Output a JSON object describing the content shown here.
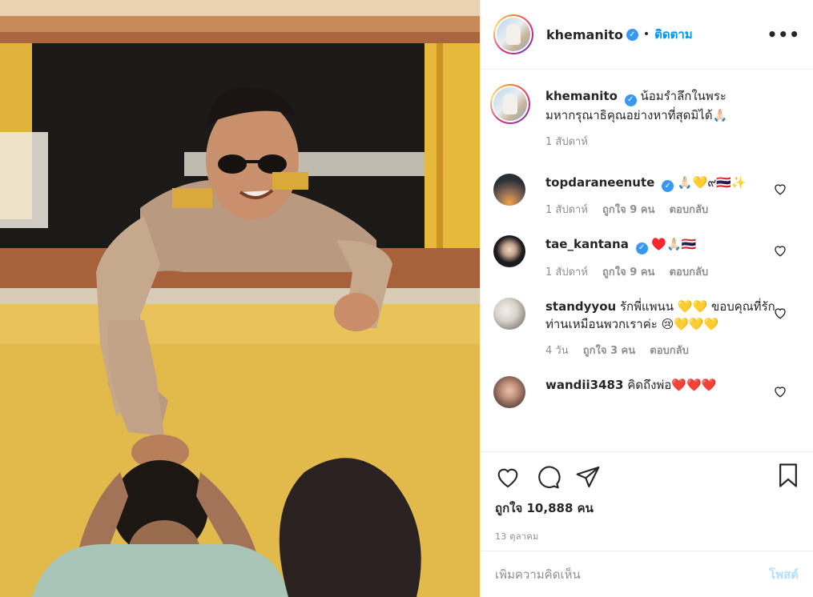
{
  "header": {
    "username": "khemanito",
    "follow_label": "ติดตาม",
    "more_label": "•••"
  },
  "caption": {
    "username": "khemanito",
    "text": "น้อมรำลึกในพระมหากรุณาธิคุณอย่างหาที่สุดมิได้🙏🏻",
    "time": "1 สัปดาห์"
  },
  "comments": [
    {
      "username": "topdaraneenute",
      "verified": true,
      "text": "🙏🏻💛๙🇹🇭✨",
      "time": "1 สัปดาห์",
      "likes": "ถูกใจ 9 คน",
      "reply": "ตอบกลับ"
    },
    {
      "username": "tae_kantana",
      "verified": true,
      "text": "♥️🙏🏻🇹🇭",
      "time": "1 สัปดาห์",
      "likes": "ถูกใจ 9 คน",
      "reply": "ตอบกลับ"
    },
    {
      "username": "standyyou",
      "verified": false,
      "text": "รักพี่แพนน 💛💛 ขอบคุณที่รักท่านเหมือนพวกเราค่ะ 😢💛💛💛",
      "time": "4 วัน",
      "likes": "ถูกใจ 3 คน",
      "reply": "ตอบกลับ"
    },
    {
      "username": "wandii3483",
      "verified": false,
      "text": "คิดถึงพ่อ❤️❤️❤️",
      "time": "",
      "likes": "",
      "reply": ""
    }
  ],
  "actions": {
    "like_count": "ถูกใจ 10,888 คน",
    "date": "13 ตุลาคม"
  },
  "add_comment": {
    "placeholder": "เพิ่มความคิดเห็น",
    "post_label": "โพสต์"
  },
  "colors": {
    "accent": "#0095f6",
    "verified": "#3897f0",
    "muted": "#8e8e8e"
  }
}
